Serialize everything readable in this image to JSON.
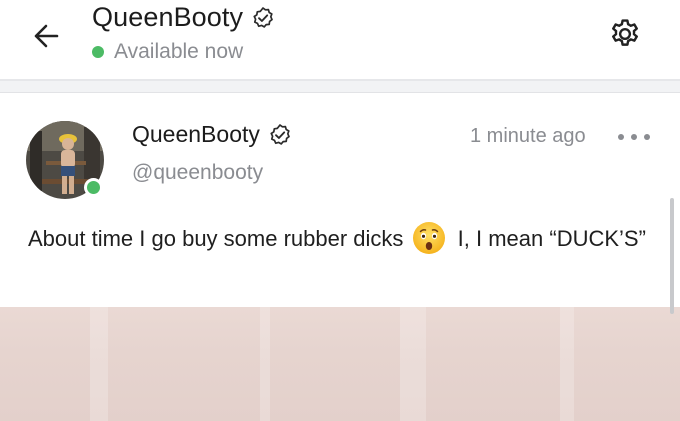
{
  "header": {
    "title": "QueenBooty",
    "status": "Available now",
    "status_color": "#4cbb65"
  },
  "post": {
    "author_name": "QueenBooty",
    "handle": "@queenbooty",
    "timestamp": "1 minute ago",
    "text_before_emoji": "About time I go buy some rubber dicks",
    "emoji": "hushed-face",
    "text_after_emoji": "I, I mean “DUCK’S”"
  },
  "icons": {
    "back": "arrow-left-icon",
    "verified": "verified-badge-icon",
    "settings": "gear-icon",
    "more": "more-horizontal-icon"
  },
  "colors": {
    "online": "#4cbb65",
    "muted_text": "#8a8c91"
  }
}
